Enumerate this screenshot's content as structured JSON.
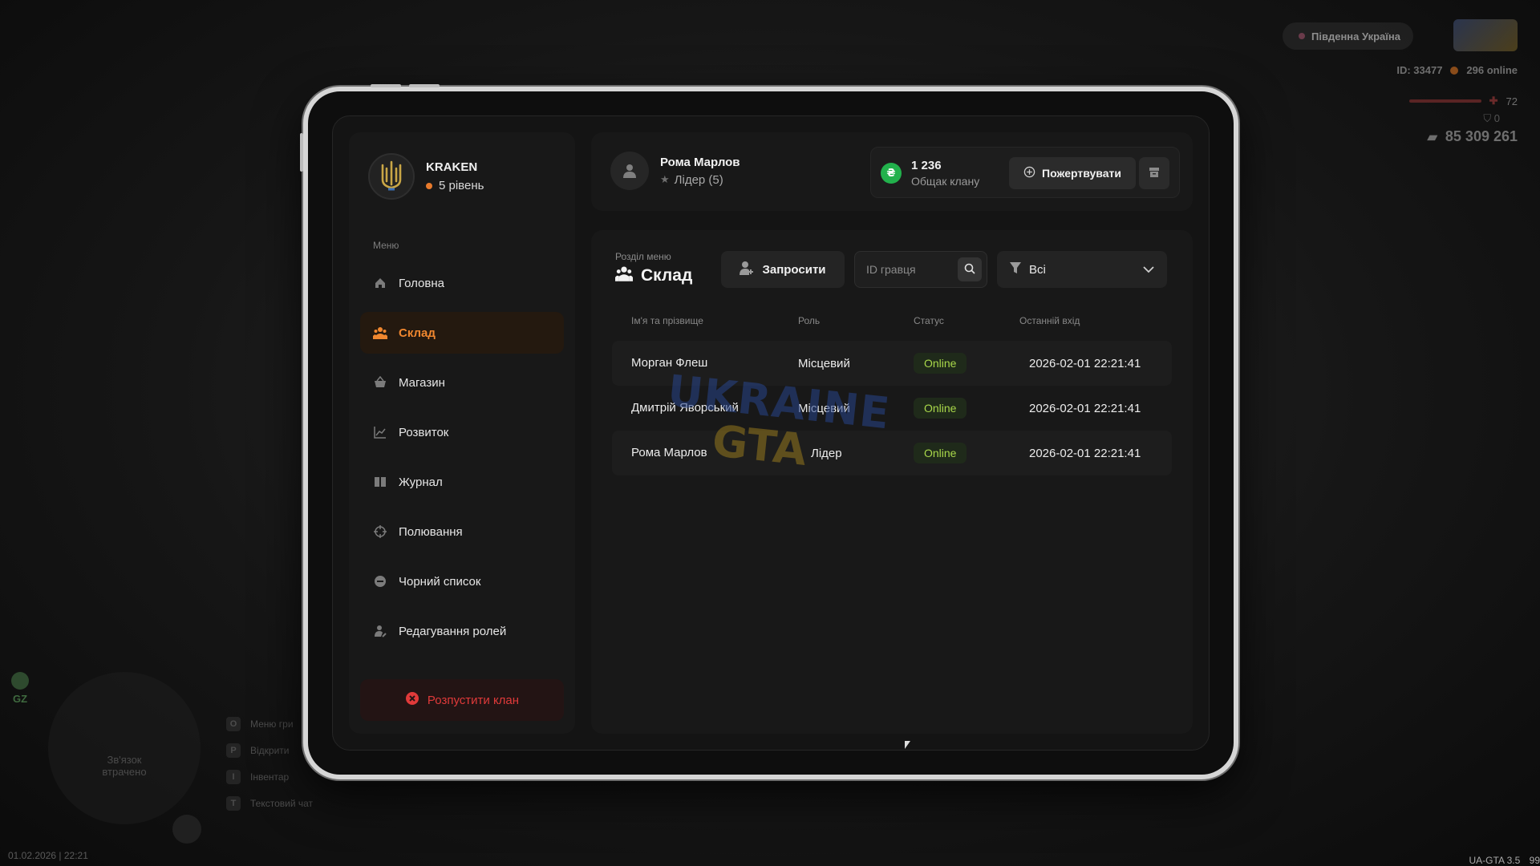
{
  "hud": {
    "server_name": "Південна Україна",
    "player_id": "ID: 33477",
    "online": "296 online",
    "health": "72",
    "armor": "0",
    "money": "85 309 261",
    "gz": "GZ",
    "radar_text": "Зв'язок втрачено",
    "keys": [
      {
        "key": "O",
        "label": "Меню гри"
      },
      {
        "key": "P",
        "label": "Відкрити"
      },
      {
        "key": "I",
        "label": "Інвентар"
      },
      {
        "key": "T",
        "label": "Текстовий чат"
      }
    ],
    "datetime": "01.02.2026 | 22:21",
    "version": "UA-GTA 3.5",
    "fps": "99"
  },
  "clan": {
    "name": "KRAKEN",
    "level": "5 рівень",
    "menu_caption": "Меню",
    "disband_label": "Розпустити клан"
  },
  "menu": {
    "items": [
      {
        "label": "Головна",
        "icon": "home-icon"
      },
      {
        "label": "Склад",
        "icon": "people-icon",
        "active": true
      },
      {
        "label": "Магазин",
        "icon": "basket-icon"
      },
      {
        "label": "Розвиток",
        "icon": "chart-icon"
      },
      {
        "label": "Журнал",
        "icon": "book-icon"
      },
      {
        "label": "Полювання",
        "icon": "crosshair-icon"
      },
      {
        "label": "Чорний список",
        "icon": "minus-circle-icon"
      },
      {
        "label": "Редагування ролей",
        "icon": "user-edit-icon"
      }
    ]
  },
  "user": {
    "name": "Рома Марлов",
    "role": "Лідер (5)"
  },
  "bank": {
    "amount": "1 236",
    "label": "Общак клану",
    "currency_symbol": "₴",
    "donate_label": "Пожертвувати"
  },
  "section": {
    "caption": "Розділ меню",
    "title": "Склад",
    "invite_label": "Запросити",
    "search_placeholder": "ID гравця",
    "filter_value": "Всі"
  },
  "table": {
    "headers": [
      "Ім'я та прізвище",
      "Роль",
      "Статус",
      "Останній вхід"
    ],
    "rows": [
      {
        "name": "Морган Флеш",
        "role": "Місцевий",
        "status": "Online",
        "last_login": "2026-02-01 22:21:41"
      },
      {
        "name": "Дмитрій Яворський",
        "role": "Місцевий",
        "status": "Online",
        "last_login": "2026-02-01 22:21:41"
      },
      {
        "name": "Рома Марлов",
        "role": "Лідер",
        "status": "Online",
        "last_login": "2026-02-01 22:21:41"
      }
    ]
  },
  "watermark": {
    "line1": "UKRAINE",
    "line2": "GTA"
  },
  "colors": {
    "accent": "#f0872f",
    "online": "#a9d84a",
    "danger": "#e03a3a",
    "coin": "#22b14c"
  }
}
